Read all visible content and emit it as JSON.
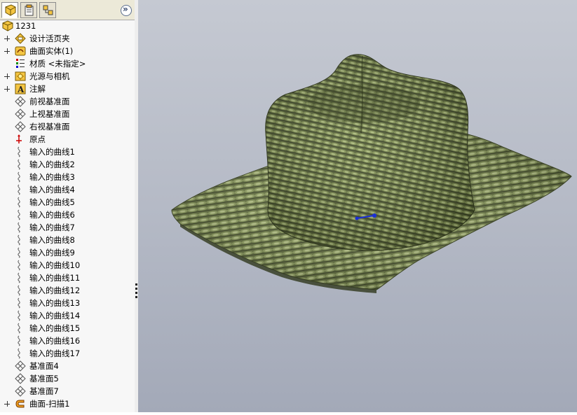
{
  "feature_tree": {
    "root": {
      "label": "1231",
      "icon": "part-icon"
    },
    "items": [
      {
        "label": "设计活页夹",
        "icon": "design-binder-icon",
        "expandable": true
      },
      {
        "label": "曲面实体(1)",
        "icon": "surface-bodies-icon",
        "expandable": true
      },
      {
        "label": "材质 <未指定>",
        "icon": "material-icon",
        "expandable": false
      },
      {
        "label": "光源与相机",
        "icon": "lights-cameras-icon",
        "expandable": true
      },
      {
        "label": "注解",
        "icon": "annotations-icon",
        "expandable": true
      },
      {
        "label": "前视基准面",
        "icon": "plane-icon",
        "expandable": false
      },
      {
        "label": "上视基准面",
        "icon": "plane-icon",
        "expandable": false
      },
      {
        "label": "右视基准面",
        "icon": "plane-icon",
        "expandable": false
      },
      {
        "label": "原点",
        "icon": "origin-icon",
        "expandable": false
      },
      {
        "label": "输入的曲线1",
        "icon": "curve-icon",
        "expandable": false
      },
      {
        "label": "输入的曲线2",
        "icon": "curve-icon",
        "expandable": false
      },
      {
        "label": "输入的曲线3",
        "icon": "curve-icon",
        "expandable": false
      },
      {
        "label": "输入的曲线4",
        "icon": "curve-icon",
        "expandable": false
      },
      {
        "label": "输入的曲线5",
        "icon": "curve-icon",
        "expandable": false
      },
      {
        "label": "输入的曲线6",
        "icon": "curve-icon",
        "expandable": false
      },
      {
        "label": "输入的曲线7",
        "icon": "curve-icon",
        "expandable": false
      },
      {
        "label": "输入的曲线8",
        "icon": "curve-icon",
        "expandable": false
      },
      {
        "label": "输入的曲线9",
        "icon": "curve-icon",
        "expandable": false
      },
      {
        "label": "输入的曲线10",
        "icon": "curve-icon",
        "expandable": false
      },
      {
        "label": "输入的曲线11",
        "icon": "curve-icon",
        "expandable": false
      },
      {
        "label": "输入的曲线12",
        "icon": "curve-icon",
        "expandable": false
      },
      {
        "label": "输入的曲线13",
        "icon": "curve-icon",
        "expandable": false
      },
      {
        "label": "输入的曲线14",
        "icon": "curve-icon",
        "expandable": false
      },
      {
        "label": "输入的曲线15",
        "icon": "curve-icon",
        "expandable": false
      },
      {
        "label": "输入的曲线16",
        "icon": "curve-icon",
        "expandable": false
      },
      {
        "label": "输入的曲线17",
        "icon": "curve-icon",
        "expandable": false
      },
      {
        "label": "基准面4",
        "icon": "plane-icon",
        "expandable": false
      },
      {
        "label": "基准面5",
        "icon": "plane-icon",
        "expandable": false
      },
      {
        "label": "基准面7",
        "icon": "plane-icon",
        "expandable": false
      },
      {
        "label": "曲面-扫描1",
        "icon": "sweep-surface-icon",
        "expandable": true
      }
    ]
  },
  "panel_tabs": [
    {
      "name": "feature-manager-tab",
      "icon": "feature-manager-icon"
    },
    {
      "name": "property-manager-tab",
      "icon": "property-manager-icon"
    },
    {
      "name": "configuration-manager-tab",
      "icon": "configuration-manager-icon"
    }
  ],
  "colors": {
    "viewport_top": "#c5c9d2",
    "viewport_bottom": "#a3a9b8",
    "hat_straw": "#6b7a45",
    "triad_blue": "#1a2fd6"
  },
  "viewport": {
    "model": "straw-hat",
    "icon": "origin-triad-icon"
  }
}
